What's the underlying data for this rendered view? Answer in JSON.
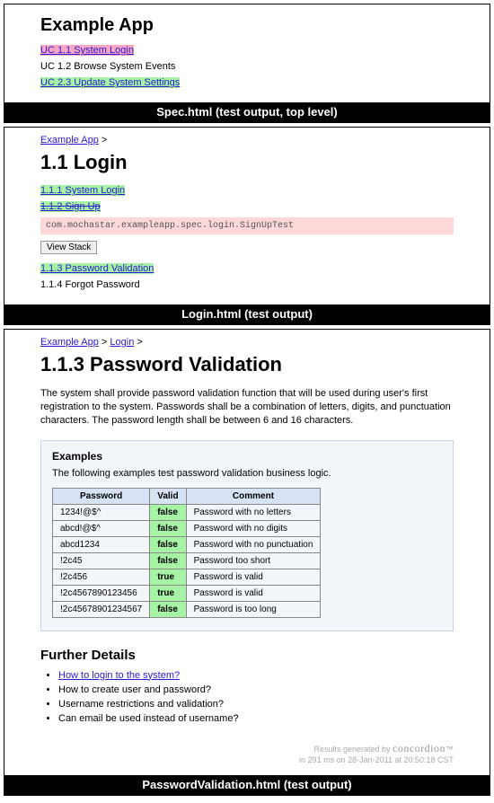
{
  "frame1": {
    "title": "Example App",
    "links": [
      {
        "label": "UC 1.1 System Login",
        "style": "pink"
      },
      {
        "label": "UC 1.2 Browse System Events",
        "style": "plain"
      },
      {
        "label": "UC 2.3 Update System Settings",
        "style": "green"
      }
    ],
    "caption": "Spec.html (test output, top level)"
  },
  "frame2": {
    "breadcrumb": {
      "app": "Example App",
      "sep": ">"
    },
    "title": "1.1 Login",
    "items": [
      {
        "label": "1.1.1 System Login",
        "style": "green-link"
      },
      {
        "label": "1.1.2 Sign Up",
        "style": "green-strike"
      }
    ],
    "error": "com.mochastar.exampleapp.spec.login.SignUpTest",
    "viewStack": "View Stack",
    "items2": [
      {
        "label": "1.1.3 Password Validation",
        "style": "green-link"
      },
      {
        "label": "1.1.4 Forgot Password",
        "style": "plain"
      }
    ],
    "caption": "Login.html (test output)"
  },
  "frame3": {
    "breadcrumb": {
      "app": "Example App",
      "sep1": ">",
      "login": "Login",
      "sep2": ">"
    },
    "title": "1.1.3 Password Validation",
    "desc": "The system shall provide password validation function that will be used during user's first registration to the system. Passwords shall be a combination of letters, digits, and punctuation characters. The password length shall be between 6 and 16 characters.",
    "examples": {
      "heading": "Examples",
      "sub": "The following examples test password validation business logic.",
      "headers": {
        "c1": "Password",
        "c2": "Valid",
        "c3": "Comment"
      },
      "rows": [
        {
          "pw": "1234!@$^",
          "valid": "false",
          "comment": "Password with no letters"
        },
        {
          "pw": "abcd!@$^",
          "valid": "false",
          "comment": "Password with no digits"
        },
        {
          "pw": "abcd1234",
          "valid": "false",
          "comment": "Password with no punctuation"
        },
        {
          "pw": "!2c45",
          "valid": "false",
          "comment": "Password too short"
        },
        {
          "pw": "!2c456",
          "valid": "true",
          "comment": "Password is valid"
        },
        {
          "pw": "!2c4567890123456",
          "valid": "true",
          "comment": "Password is valid"
        },
        {
          "pw": "!2c45678901234567",
          "valid": "false",
          "comment": "Password is too long"
        }
      ]
    },
    "further": {
      "heading": "Further Details",
      "items": [
        {
          "label": "How to login to the system?",
          "link": true
        },
        {
          "label": "How to create user and password?",
          "link": false
        },
        {
          "label": "Username restrictions and validation?",
          "link": false
        },
        {
          "label": "Can email be used instead of username?",
          "link": false
        }
      ]
    },
    "footer": {
      "line1_prefix": "Results generated by ",
      "brand": "concordion",
      "line2": "in 291 ms on 28-Jan-2011 at 20:50:18 CST"
    },
    "caption": "PasswordValidation.html (test output)"
  }
}
